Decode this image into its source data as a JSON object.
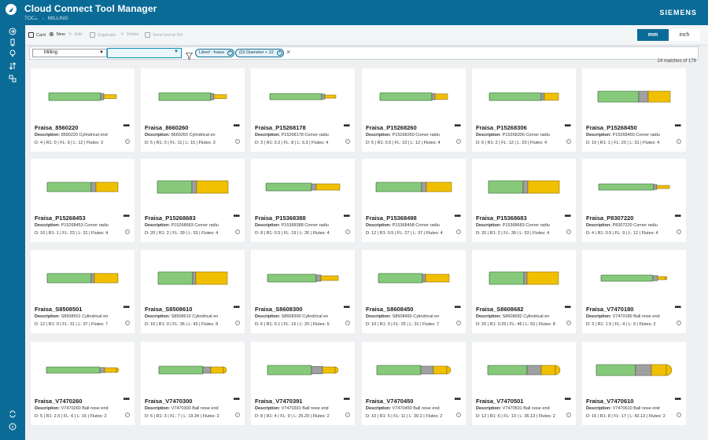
{
  "app": {
    "title": "Cloud Connect Tool Manager",
    "brand": "SIEMENS"
  },
  "breadcrumb": [
    "TOOL",
    "MILLING"
  ],
  "toolbar": {
    "card": "Card",
    "new": "New",
    "edit": "Edit",
    "duplicate": "Duplicate",
    "delete": "Delete",
    "send": "Send tool to NX"
  },
  "units": {
    "mm": "mm",
    "inch": "inch",
    "selected": "mm"
  },
  "filter": {
    "category": "Milling",
    "chips": [
      "Libref : fraisa",
      "(D) Diameter < 22"
    ],
    "matches": "24 matches of 178"
  },
  "colors": {
    "accent": "#0a6b96",
    "shank": "#86c97a",
    "cutter": "#f0c000",
    "neck": "#a0a0a0"
  },
  "cards": [
    {
      "name": "Fraisa_8560220",
      "desc_label": "Description:",
      "desc": "8560220 Cylindrical end",
      "specs": "D: 4 | R1: 0 | FL: 9 | L: 12 | Flutes: 3",
      "shape": "cyl"
    },
    {
      "name": "Fraisa_8660260",
      "desc_label": "Description:",
      "desc": "8660260 Cylindrical en",
      "specs": "D: 5 | R1: 0 | FL: 11 | L: 15 | Flutes: 3",
      "shape": "cyl"
    },
    {
      "name": "Fraisa_P15268178",
      "desc_label": "Description:",
      "desc": "P15268178 Corner radiu",
      "specs": "D: 3 | R1: 0.2 | FL: 8 | L: 9.3 | Flutes: 4",
      "shape": "cyl"
    },
    {
      "name": "Fraisa_P15268260",
      "desc_label": "Description:",
      "desc": "P15268260 Corner radiu",
      "specs": "D: 5 | R1: 0.5 | FL: 10 | L: 12 | Flutes: 4",
      "shape": "cyl"
    },
    {
      "name": "Fraisa_P15268306",
      "desc_label": "Description:",
      "desc": "P15268306 Corner radiu",
      "specs": "D: 6 | R1: 2 | FL: 12 | L: 20 | Flutes: 4",
      "shape": "cyl"
    },
    {
      "name": "Fraisa_P15268450",
      "desc_label": "Description:",
      "desc": "P15268450 Corner radiu",
      "specs": "D: 10 | R1: 1 | FL: 23 | L: 31 | Flutes: 4",
      "shape": "cyl"
    },
    {
      "name": "Fraisa_P15268453",
      "desc_label": "Description:",
      "desc": "P15268453 Corner radiu",
      "specs": "D: 10 | R1: 1 | FL: 23 | L: 31 | Flutes: 4",
      "shape": "cyl"
    },
    {
      "name": "Fraisa_P15268683",
      "desc_label": "Description:",
      "desc": "P15268683 Corner radiu",
      "specs": "D: 20 | R1: 2 | FL: 39 | L: 53 | Flutes: 4",
      "shape": "cyl"
    },
    {
      "name": "Fraisa_P15368388",
      "desc_label": "Description:",
      "desc": "P15368388 Corner radiu",
      "specs": "D: 8 | R1: 0.5 | FL: 19 | L: 26 | Flutes: 4",
      "shape": "cyl"
    },
    {
      "name": "Fraisa_P15368498",
      "desc_label": "Description:",
      "desc": "P15368498 Corner radiu",
      "specs": "D: 12 | R1: 0.5 | FL: 27 | L: 37 | Flutes: 4",
      "shape": "cyl"
    },
    {
      "name": "Fraisa_P15368683",
      "desc_label": "Description:",
      "desc": "P15368683 Corner radiu",
      "specs": "D: 20 | R1: 2 | FL: 39 | L: 53 | Flutes: 4",
      "shape": "cyl"
    },
    {
      "name": "Fraisa_P8307220",
      "desc_label": "Description:",
      "desc": "P8307220 Corner radiu",
      "specs": "D: 4 | R1: 0.5 | FL: 9 | L: 12 | Flutes: 4",
      "shape": "cyl"
    },
    {
      "name": "Fraisa_S8508501",
      "desc_label": "Description:",
      "desc": "S8508501 Cylindrical en",
      "specs": "D: 12 | R1: 0 | FL: 31 | L: 37 | Flutes: 7",
      "shape": "cyl"
    },
    {
      "name": "Fraisa_S8508610",
      "desc_label": "Description:",
      "desc": "S8508610 Cylindrical en",
      "specs": "D: 16 | R1: 0 | FL: 36 | L: 43 | Flutes: 8",
      "shape": "cyl"
    },
    {
      "name": "Fraisa_S8608300",
      "desc_label": "Description:",
      "desc": "S8608300 Cylindrical en",
      "specs": "D: 6 | R1: 0.1 | FL: 16 | L: 20 | Flutes: 6",
      "shape": "cyl"
    },
    {
      "name": "Fraisa_S8608450",
      "desc_label": "Description:",
      "desc": "S8608450 Cylindrical en",
      "specs": "D: 10 | R1: 0 | FL: 25 | L: 31 | Flutes: 7",
      "shape": "cyl"
    },
    {
      "name": "Fraisa_S8608682",
      "desc_label": "Description:",
      "desc": "S8608682 Cylindrical en",
      "specs": "D: 20 | R1: 0.25 | FL: 46 | L: 53 | Flutes: 8",
      "shape": "cyl"
    },
    {
      "name": "Fraisa_V7470180",
      "desc_label": "Description:",
      "desc": "V7470180 Ball nose end",
      "specs": "D: 3 | R1: 1.5 | FL: 4 | L: 9 | Flutes: 2",
      "shape": "ball"
    },
    {
      "name": "Fraisa_V7470260",
      "desc_label": "Description:",
      "desc": "V7470260 Ball nose end",
      "specs": "D: 5 | R1: 2.5 | FL: 6 | L: 15 | Flutes: 2",
      "shape": "ball"
    },
    {
      "name": "Fraisa_V7470300",
      "desc_label": "Description:",
      "desc": "V7470300 Ball nose end",
      "specs": "D: 6 | R1: 3 | FL: 7 | L: 19.34 | Flutes: 2",
      "shape": "ball"
    },
    {
      "name": "Fraisa_V7470391",
      "desc_label": "Description:",
      "desc": "V7470391 Ball nose end",
      "specs": "D: 8 | R1: 4 | FL: 9 | L: 25.29 | Flutes: 2",
      "shape": "ball"
    },
    {
      "name": "Fraisa_V7470450",
      "desc_label": "Description:",
      "desc": "V7470450 Ball nose end",
      "specs": "D: 10 | R1: 5 | FL: 11 | L: 30.2 | Flutes: 2",
      "shape": "ball"
    },
    {
      "name": "Fraisa_V7470501",
      "desc_label": "Description:",
      "desc": "V7470501 Ball nose end",
      "specs": "D: 12 | R1: 6 | FL: 13 | L: 36.13 | Flutes: 2",
      "shape": "ball"
    },
    {
      "name": "Fraisa_V7470610",
      "desc_label": "Description:",
      "desc": "V7470610 Ball nose end",
      "specs": "D: 16 | R1: 8 | FL: 17 | L: 42.13 | Flutes: 2",
      "shape": "ball"
    }
  ]
}
